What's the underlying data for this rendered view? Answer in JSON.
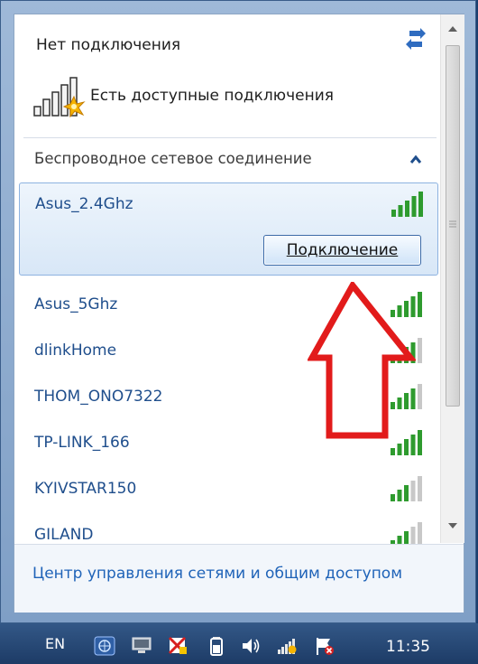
{
  "header": {
    "status_title": "Нет подключения",
    "available_text": "Есть доступные подключения"
  },
  "section": {
    "title": "Беспроводное сетевое соединение"
  },
  "networks": [
    {
      "name": "Asus_2.4Ghz",
      "signal_bars": 5,
      "selected": true
    },
    {
      "name": "Asus_5Ghz",
      "signal_bars": 5
    },
    {
      "name": "dlinkHome",
      "signal_bars": 4
    },
    {
      "name": "THOM_ONO7322",
      "signal_bars": 4
    },
    {
      "name": "TP-LINK_166",
      "signal_bars": 5
    },
    {
      "name": "KYIVSTAR150",
      "signal_bars": 3
    },
    {
      "name": "GILAND",
      "signal_bars": 3
    }
  ],
  "connect_button_label": "Подключение",
  "footer": {
    "link": "Центр управления сетями и общим доступом"
  },
  "taskbar": {
    "language": "EN",
    "clock": "11:35",
    "icons": [
      "network-center-icon",
      "display-icon",
      "security-flag-icon",
      "battery-icon",
      "volume-icon",
      "wifi-status-icon",
      "action-center-flag-icon"
    ]
  },
  "colors": {
    "signal_active": "#2e9b2e",
    "signal_inactive": "#c8c8c8",
    "link": "#1f63b8",
    "network_name": "#1f4e8c",
    "annotation_arrow": "#e21b1b"
  }
}
